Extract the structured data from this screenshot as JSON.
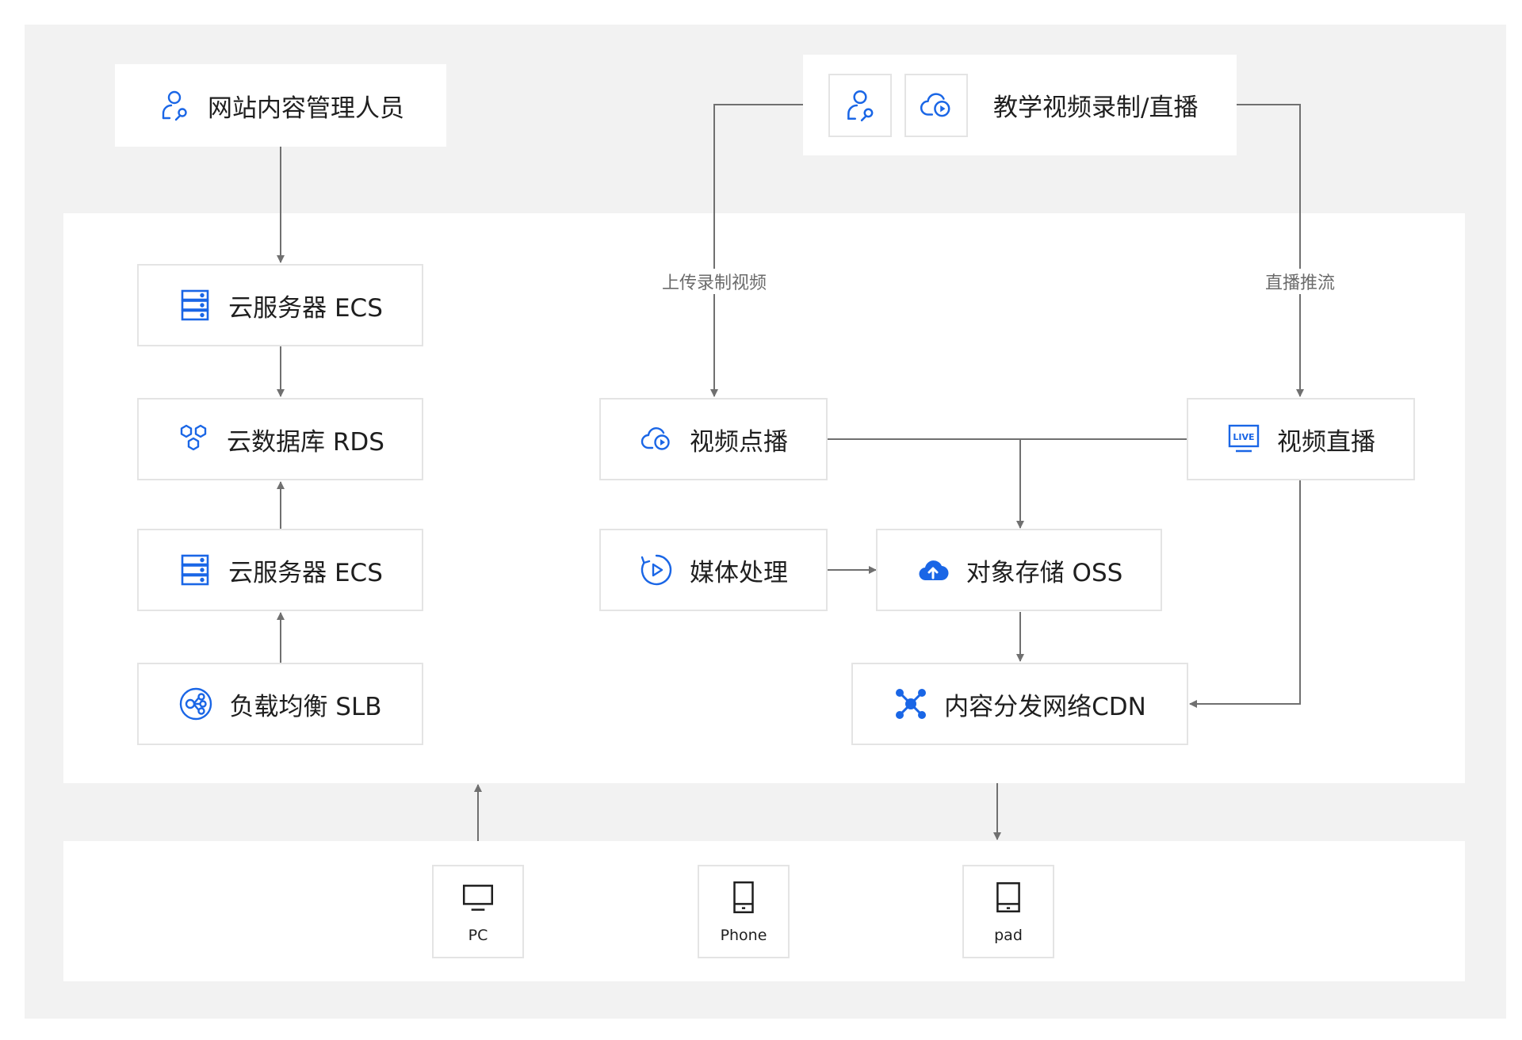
{
  "content_admin": {
    "label": "网站内容管理人员"
  },
  "recording": {
    "label": "教学视频录制/直播"
  },
  "edges": {
    "upload_label": "上传录制视频",
    "push_label": "直播推流"
  },
  "ecs_top": {
    "label": "云服务器 ECS"
  },
  "rds": {
    "label": "云数据库 RDS"
  },
  "ecs_bottom": {
    "label": "云服务器 ECS"
  },
  "slb": {
    "label": "负载均衡 SLB"
  },
  "vod": {
    "label": "视频点播"
  },
  "live": {
    "label": "视频直播"
  },
  "media": {
    "label": "媒体处理"
  },
  "oss": {
    "label": "对象存储 OSS"
  },
  "cdn": {
    "label": "内容分发网络CDN"
  },
  "clients": [
    {
      "label": "PC",
      "icon": "monitor-icon"
    },
    {
      "label": "Phone",
      "icon": "phone-icon"
    },
    {
      "label": "pad",
      "icon": "tablet-icon"
    }
  ],
  "colors": {
    "accent": "#1a66e6",
    "line": "#707070",
    "card_border": "#e4e4e4",
    "background": "#f2f2f2"
  }
}
